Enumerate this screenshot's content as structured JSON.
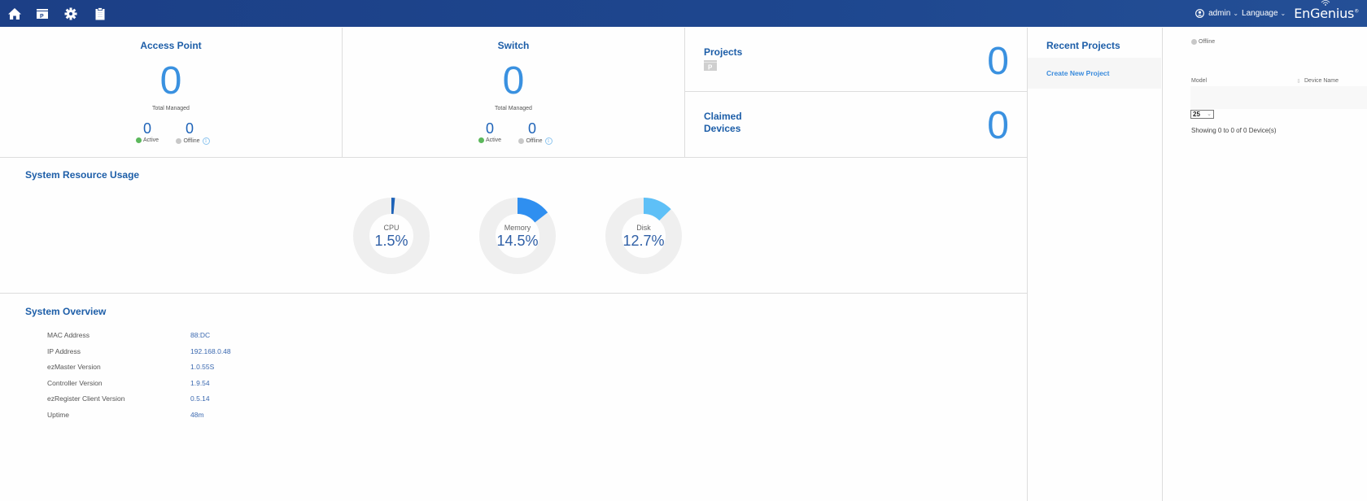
{
  "topbar": {
    "nav": [
      {
        "name": "home-icon"
      },
      {
        "name": "project-folder-icon"
      },
      {
        "name": "gear-icon"
      },
      {
        "name": "clipboard-icon"
      }
    ],
    "user": "admin",
    "language": "Language",
    "logo": "EnGenius",
    "logo_mark": "®"
  },
  "access_point": {
    "title": "Access Point",
    "total": "0",
    "total_label": "Total Managed",
    "active": "0",
    "active_label": "Active",
    "offline": "0",
    "offline_label": "Offline"
  },
  "switch": {
    "title": "Switch",
    "total": "0",
    "total_label": "Total Managed",
    "active": "0",
    "active_label": "Active",
    "offline": "0",
    "offline_label": "Offline"
  },
  "projects": {
    "title": "Projects",
    "value": "0",
    "icon_letter": "P"
  },
  "claimed": {
    "title_line1": "Claimed",
    "title_line2": "Devices",
    "value": "0"
  },
  "resource": {
    "title": "System Resource Usage",
    "gauges": [
      {
        "label": "CPU",
        "value_text": "1.5%",
        "percent": 1.5,
        "color": "#1e63b8"
      },
      {
        "label": "Memory",
        "value_text": "14.5%",
        "percent": 14.5,
        "color": "#2f8ff0"
      },
      {
        "label": "Disk",
        "value_text": "12.7%",
        "percent": 12.7,
        "color": "#5ec0f7"
      }
    ]
  },
  "overview": {
    "title": "System Overview",
    "rows": [
      {
        "key": "MAC Address",
        "value": "88:DC"
      },
      {
        "key": "IP Address",
        "value": "192.168.0.48"
      },
      {
        "key": "ezMaster Version",
        "value": "1.0.55S"
      },
      {
        "key": "Controller Version",
        "value": "1.9.54"
      },
      {
        "key": "ezRegister Client Version",
        "value": "0.5.14"
      },
      {
        "key": "Uptime",
        "value": "48m"
      }
    ]
  },
  "recent": {
    "title": "Recent Projects",
    "create_label": "Create New Project"
  },
  "devices_panel": {
    "legend_offline": "Offline",
    "col_model": "Model",
    "col_device_name": "Device Name",
    "page_size": "25",
    "showing": "Showing 0 to 0 of 0 Device(s)"
  }
}
